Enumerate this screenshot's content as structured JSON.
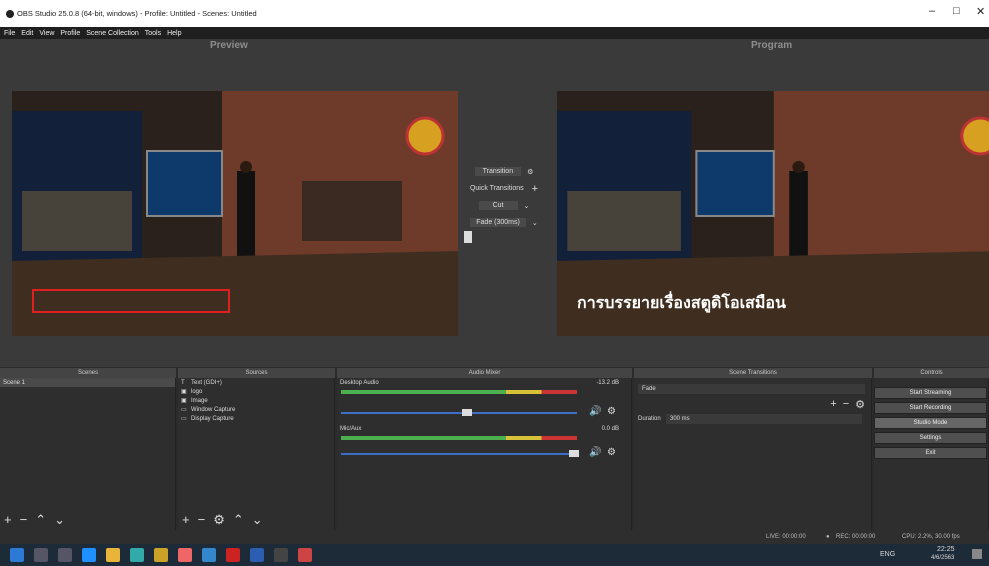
{
  "window": {
    "title": "OBS Studio 25.0.8 (64-bit, windows) - Profile: Untitled - Scenes: Untitled",
    "controls": [
      "–",
      "□",
      "✕"
    ]
  },
  "menu": [
    "File",
    "Edit",
    "View",
    "Profile",
    "Scene Collection",
    "Tools",
    "Help"
  ],
  "preview": {
    "label": "Preview"
  },
  "program": {
    "label": "Program",
    "caption": "การบรรยายเรื่องสตูดิโอเสมือน"
  },
  "transition_panel": {
    "transition_label": "Transition",
    "quick_transitions_label": "Quick Transitions",
    "cut_label": "Cut",
    "fade_label": "Fade (300ms)"
  },
  "docks": {
    "scenes": {
      "title": "Scenes",
      "items": [
        "Scene 1"
      ]
    },
    "sources": {
      "title": "Sources",
      "items": [
        {
          "icon": "text-icon",
          "label": "Text (GDI+)"
        },
        {
          "icon": "image-icon",
          "label": "logo"
        },
        {
          "icon": "image-icon",
          "label": "Image"
        },
        {
          "icon": "window-capture-icon",
          "label": "Window Capture"
        },
        {
          "icon": "display-capture-icon",
          "label": "Display Capture"
        }
      ]
    },
    "mixer": {
      "title": "Audio Mixer",
      "channels": [
        {
          "name": "Desktop Audio",
          "db": "-13.2 dB",
          "volume": 0.4
        },
        {
          "name": "Mic/Aux",
          "db": "0.0 dB",
          "volume": 1.0
        }
      ]
    },
    "transitions": {
      "title": "Scene Transitions",
      "selected": "Fade",
      "duration_label": "Duration",
      "duration_value": "300 ms"
    },
    "controls": {
      "title": "Controls",
      "buttons": [
        "Start Streaming",
        "Start Recording",
        "Studio Mode",
        "Settings",
        "Exit"
      ]
    }
  },
  "status": {
    "live": "LIVE: 00:00:00",
    "rec": "REC: 00:00:00",
    "cpu": "CPU: 2.2%, 30.00 fps"
  },
  "taskbar": {
    "lang": "ENG",
    "time": "22:25",
    "date": "4/6/2563"
  },
  "colors": {
    "accent": "#3d6fc7",
    "meter_green": "#4caf50",
    "meter_yellow": "#d8c23a",
    "meter_red": "#c33",
    "selection": "#e02020"
  }
}
